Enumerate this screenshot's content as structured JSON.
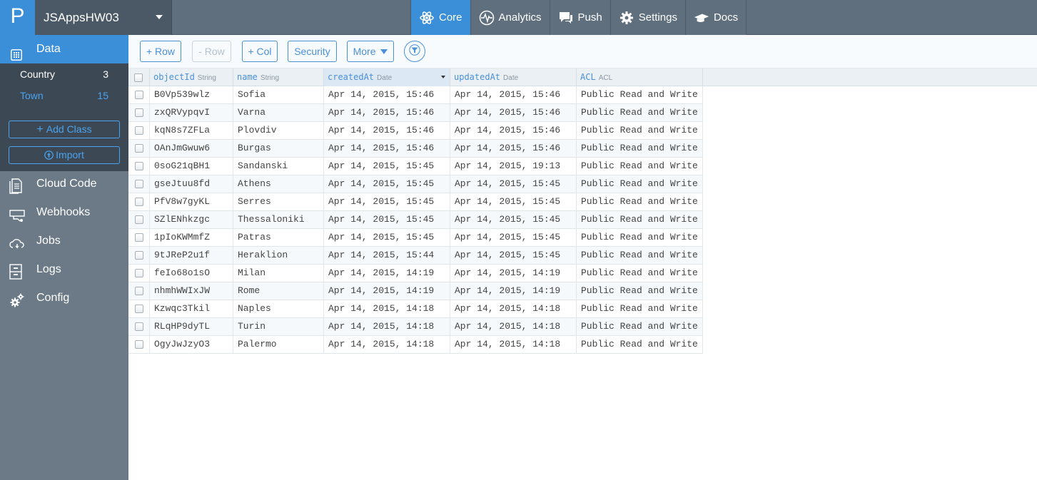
{
  "app": {
    "logo": "P",
    "name": "JSAppsHW03"
  },
  "topnav": [
    {
      "label": "Core",
      "icon": "atom-icon",
      "active": true
    },
    {
      "label": "Analytics",
      "icon": "pulse-icon",
      "active": false
    },
    {
      "label": "Push",
      "icon": "chat-bubble-icon",
      "active": false
    },
    {
      "label": "Settings",
      "icon": "gear-icon",
      "active": false
    },
    {
      "label": "Docs",
      "icon": "graduation-cap-icon",
      "active": false
    }
  ],
  "sidebar": {
    "data_label": "Data",
    "classes": [
      {
        "name": "Country",
        "count": "3"
      },
      {
        "name": "Town",
        "count": "15"
      }
    ],
    "add_class_label": "Add Class",
    "import_label": "Import",
    "nav": [
      {
        "label": "Cloud Code",
        "icon": "document-stack-icon"
      },
      {
        "label": "Webhooks",
        "icon": "webhook-icon"
      },
      {
        "label": "Jobs",
        "icon": "cloud-refresh-icon"
      },
      {
        "label": "Logs",
        "icon": "cabinet-icon"
      },
      {
        "label": "Config",
        "icon": "gears-icon"
      }
    ]
  },
  "toolbar": {
    "add_row": "+ Row",
    "remove_row": "- Row",
    "add_col": "+ Col",
    "security": "Security",
    "more": "More"
  },
  "table": {
    "columns": [
      {
        "name": "objectId",
        "type": "String"
      },
      {
        "name": "name",
        "type": "String"
      },
      {
        "name": "createdAt",
        "type": "Date"
      },
      {
        "name": "updatedAt",
        "type": "Date"
      },
      {
        "name": "ACL",
        "type": "ACL"
      }
    ],
    "rows": [
      [
        "B0Vp539wlz",
        "Sofia",
        "Apr 14, 2015, 15:46",
        "Apr 14, 2015, 15:46",
        "Public Read and Write"
      ],
      [
        "zxQRVypqvI",
        "Varna",
        "Apr 14, 2015, 15:46",
        "Apr 14, 2015, 15:46",
        "Public Read and Write"
      ],
      [
        "kqN8s7ZFLa",
        "Plovdiv",
        "Apr 14, 2015, 15:46",
        "Apr 14, 2015, 15:46",
        "Public Read and Write"
      ],
      [
        "OAnJmGwuw6",
        "Burgas",
        "Apr 14, 2015, 15:46",
        "Apr 14, 2015, 15:46",
        "Public Read and Write"
      ],
      [
        "0soG21qBH1",
        "Sandanski",
        "Apr 14, 2015, 15:45",
        "Apr 14, 2015, 19:13",
        "Public Read and Write"
      ],
      [
        "gseJtuu8fd",
        "Athens",
        "Apr 14, 2015, 15:45",
        "Apr 14, 2015, 15:45",
        "Public Read and Write"
      ],
      [
        "PfV8w7gyKL",
        "Serres",
        "Apr 14, 2015, 15:45",
        "Apr 14, 2015, 15:45",
        "Public Read and Write"
      ],
      [
        "SZlENhkzgc",
        "Thessaloniki",
        "Apr 14, 2015, 15:45",
        "Apr 14, 2015, 15:45",
        "Public Read and Write"
      ],
      [
        "1pIoKWMmfZ",
        "Patras",
        "Apr 14, 2015, 15:45",
        "Apr 14, 2015, 15:45",
        "Public Read and Write"
      ],
      [
        "9tJReP2u1f",
        "Heraklion",
        "Apr 14, 2015, 15:44",
        "Apr 14, 2015, 15:45",
        "Public Read and Write"
      ],
      [
        "feIo68o1sO",
        "Milan",
        "Apr 14, 2015, 14:19",
        "Apr 14, 2015, 14:19",
        "Public Read and Write"
      ],
      [
        "nhmhWWIxJW",
        "Rome",
        "Apr 14, 2015, 14:19",
        "Apr 14, 2015, 14:19",
        "Public Read and Write"
      ],
      [
        "Kzwqc3Tkil",
        "Naples",
        "Apr 14, 2015, 14:18",
        "Apr 14, 2015, 14:18",
        "Public Read and Write"
      ],
      [
        "RLqHP9dyTL",
        "Turin",
        "Apr 14, 2015, 14:18",
        "Apr 14, 2015, 14:18",
        "Public Read and Write"
      ],
      [
        "OgyJwJzyO3",
        "Palermo",
        "Apr 14, 2015, 14:18",
        "Apr 14, 2015, 14:18",
        "Public Read and Write"
      ]
    ]
  },
  "colors": {
    "accent": "#3a8fd8",
    "topbar": "#5f6f7d",
    "sidebar": "#6c7a87",
    "class_panel": "#3c4853"
  }
}
